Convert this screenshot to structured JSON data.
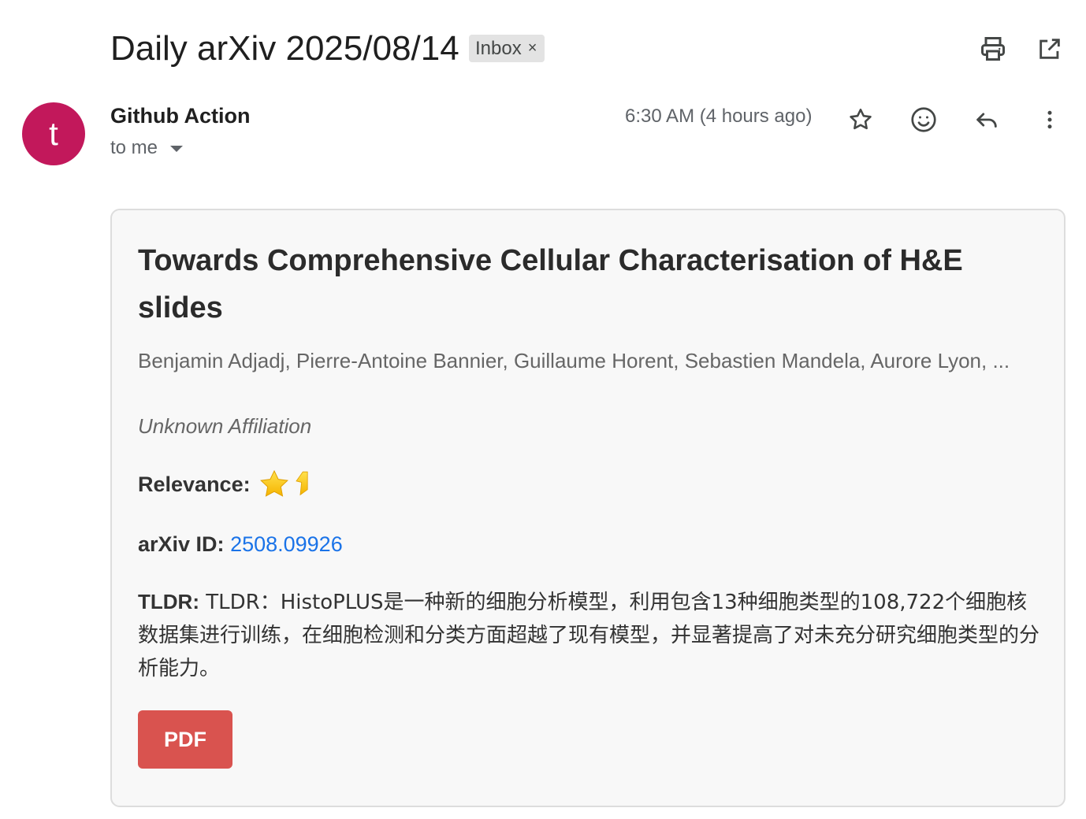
{
  "email": {
    "subject": "Daily arXiv 2025/08/14",
    "label": "Inbox",
    "label_remove": "×",
    "sender": {
      "avatar_letter": "t",
      "avatar_color": "#c2185b",
      "name": "Github Action",
      "recipient": "to me"
    },
    "timestamp": "6:30 AM (4 hours ago)",
    "toolbar_icons": [
      "print-icon",
      "open-in-new-window-icon"
    ],
    "action_icons": [
      "star-icon",
      "emoji-reaction-icon",
      "reply-icon",
      "more-vert-icon"
    ]
  },
  "paper": {
    "title": "Towards Comprehensive Cellular Characterisation of H&E slides",
    "authors": "Benjamin Adjadj, Pierre-Antoine Bannier, Guillaume Horent, Sebastien Mandela, Aurore Lyon, ...",
    "affiliation": "Unknown Affiliation",
    "relevance_label": "Relevance:",
    "relevance_stars": 1.5,
    "arxiv_label": "arXiv ID:",
    "arxiv_id": "2508.09926",
    "tldr_label": "TLDR:",
    "tldr_text": "TLDR：HistoPLUS是一种新的细胞分析模型，利用包含13种细胞类型的108,722个细胞核数据集进行训练，在细胞检测和分类方面超越了现有模型，并显著提高了对未充分研究细胞类型的分析能力。",
    "pdf_button": "PDF",
    "pdf_button_color": "#d9534f",
    "link_color": "#1a73e8"
  }
}
